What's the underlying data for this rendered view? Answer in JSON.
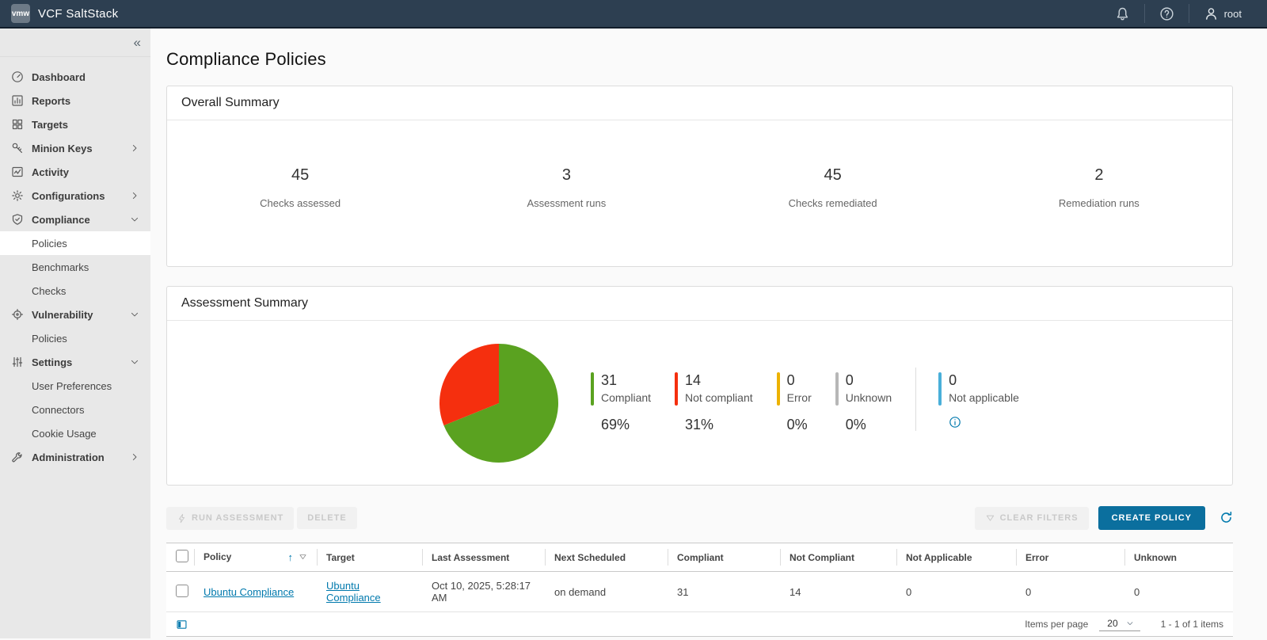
{
  "topbar": {
    "logo": "vmw",
    "title": "VCF SaltStack",
    "user": "root"
  },
  "sidebar": {
    "items": [
      {
        "label": "Dashboard",
        "icon": "gauge",
        "level": 1
      },
      {
        "label": "Reports",
        "icon": "bar-chart",
        "level": 1
      },
      {
        "label": "Targets",
        "icon": "grid",
        "level": 1
      },
      {
        "label": "Minion Keys",
        "icon": "key",
        "level": 1,
        "chevron": "right"
      },
      {
        "label": "Activity",
        "icon": "activity",
        "level": 1
      },
      {
        "label": "Configurations",
        "icon": "gear",
        "level": 1,
        "chevron": "right"
      },
      {
        "label": "Compliance",
        "icon": "shield",
        "level": 1,
        "chevron": "down"
      },
      {
        "label": "Policies",
        "level": 2,
        "active": true
      },
      {
        "label": "Benchmarks",
        "level": 2
      },
      {
        "label": "Checks",
        "level": 2
      },
      {
        "label": "Vulnerability",
        "icon": "target",
        "level": 1,
        "chevron": "down"
      },
      {
        "label": "Policies",
        "level": 2
      },
      {
        "label": "Settings",
        "icon": "sliders",
        "level": 1,
        "chevron": "down"
      },
      {
        "label": "User Preferences",
        "level": 2
      },
      {
        "label": "Connectors",
        "level": 2
      },
      {
        "label": "Cookie Usage",
        "level": 2
      },
      {
        "label": "Administration",
        "icon": "wrench",
        "level": 1,
        "chevron": "right"
      }
    ]
  },
  "page": {
    "title": "Compliance Policies"
  },
  "overall_summary": {
    "title": "Overall Summary",
    "stats": [
      {
        "value": "45",
        "label": "Checks assessed"
      },
      {
        "value": "3",
        "label": "Assessment runs"
      },
      {
        "value": "45",
        "label": "Checks remediated"
      },
      {
        "value": "2",
        "label": "Remediation runs"
      }
    ]
  },
  "assessment_summary": {
    "title": "Assessment Summary",
    "chart_data": {
      "type": "pie",
      "labels": [
        "Compliant",
        "Not compliant",
        "Error",
        "Unknown",
        "Not applicable"
      ],
      "values": [
        31,
        14,
        0,
        0,
        0
      ],
      "percents": [
        "69%",
        "31%",
        "0%",
        "0%",
        ""
      ],
      "colors": [
        "#5aa220",
        "#f52f0e",
        "#edb200",
        "#b7b7b7",
        "#49afd9"
      ],
      "total": 45
    },
    "legend": [
      {
        "value": "31",
        "label": "Compliant",
        "percent": "69%",
        "color": "#5aa220"
      },
      {
        "value": "14",
        "label": "Not compliant",
        "percent": "31%",
        "color": "#f52f0e"
      },
      {
        "value": "0",
        "label": "Error",
        "percent": "0%",
        "color": "#edb200"
      },
      {
        "value": "0",
        "label": "Unknown",
        "percent": "0%",
        "color": "#b7b7b7"
      },
      {
        "value": "0",
        "label": "Not applicable",
        "percent": "",
        "color": "#49afd9",
        "info": true,
        "divider_before": true
      }
    ]
  },
  "toolbar": {
    "run_assessment": "Run Assessment",
    "delete": "Delete",
    "clear_filters": "Clear Filters",
    "create_policy": "Create Policy"
  },
  "table": {
    "columns": [
      "Policy",
      "Target",
      "Last Assessment",
      "Next Scheduled",
      "Compliant",
      "Not Compliant",
      "Not Applicable",
      "Error",
      "Unknown"
    ],
    "rows": [
      [
        "Ubuntu Compliance",
        "Ubuntu Compliance",
        "Oct 10, 2025, 5:28:17 AM",
        "on demand",
        "31",
        "14",
        "0",
        "0",
        "0"
      ]
    ],
    "footer": {
      "items_per_page_label": "Items per page",
      "items_per_page": "20",
      "range": "1 - 1 of 1 items"
    }
  }
}
